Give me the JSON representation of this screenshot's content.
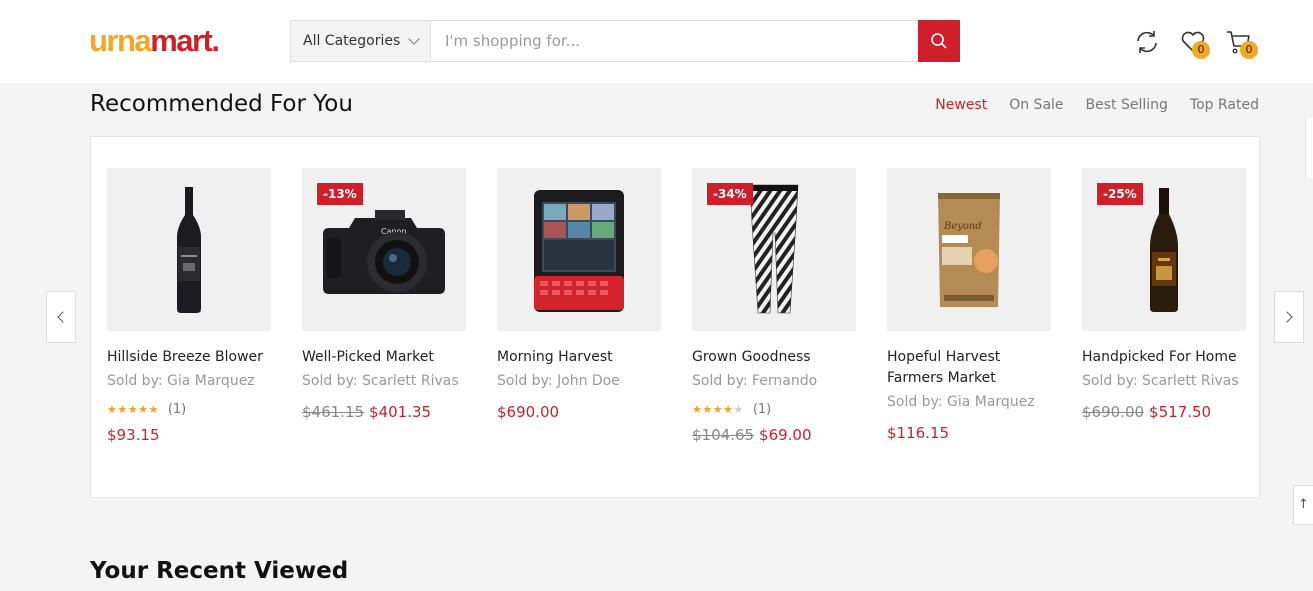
{
  "header": {
    "logo_part1": "urna",
    "logo_part2": "mart.",
    "category_label": "All Categories",
    "search_placeholder": "I'm shopping for...",
    "wishlist_count": "0",
    "cart_count": "0",
    "icons": [
      "refresh-icon",
      "heart-icon",
      "cart-icon",
      "search-icon"
    ]
  },
  "recommended": {
    "title": "Recommended For You",
    "filters": [
      "Newest",
      "On Sale",
      "Best Selling",
      "Top Rated"
    ],
    "active_filter": "Newest",
    "products": [
      {
        "name": "Hillside Breeze Blower",
        "seller": "Sold by: Gia Marquez",
        "rating_count": "(1)",
        "rating": 5,
        "old_price": "",
        "price": "$93.15",
        "sale_badge": ""
      },
      {
        "name": "Well-Picked Market",
        "seller": "Sold by: Scarlett Rivas",
        "old_price": "$461.15",
        "price": "$401.35",
        "sale_badge": "-13%"
      },
      {
        "name": "Morning Harvest",
        "seller": "Sold by: John Doe",
        "old_price": "",
        "price": "$690.00",
        "sale_badge": ""
      },
      {
        "name": "Grown Goodness",
        "seller": "Sold by: Fernando",
        "rating_count": "(1)",
        "rating": 4,
        "old_price": "$104.65",
        "price": "$69.00",
        "sale_badge": "-34%"
      },
      {
        "name": "Hopeful Harvest Farmers Market",
        "seller": "Sold by: Gia Marquez",
        "old_price": "",
        "price": "$116.15",
        "sale_badge": ""
      },
      {
        "name": "Handpicked For Home",
        "seller": "Sold by: Scarlett Rivas",
        "old_price": "$690.00",
        "price": "$517.50",
        "sale_badge": "-25%"
      }
    ]
  },
  "recent": {
    "title": "Your Recent Viewed"
  },
  "colors": {
    "brand_red": "#cf1f2a",
    "brand_orange": "#f5a623"
  }
}
